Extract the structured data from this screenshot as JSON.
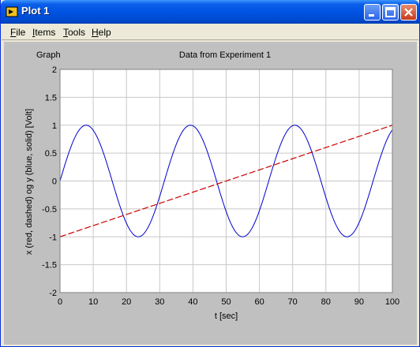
{
  "window": {
    "title": "Plot 1"
  },
  "menu": [
    {
      "label": "File",
      "mnemonic": "F",
      "rest": "ile"
    },
    {
      "label": "Items",
      "mnemonic": "I",
      "rest": "tems"
    },
    {
      "label": "Tools",
      "mnemonic": "T",
      "rest": "ools"
    },
    {
      "label": "Help",
      "mnemonic": "H",
      "rest": "elp"
    }
  ],
  "graph": {
    "label": "Graph"
  },
  "chart_data": {
    "type": "line",
    "title": "Data from Experiment 1",
    "xlabel": "t [sec]",
    "ylabel": "x (red, dashed) og y (blue, solid) [Volt]",
    "xlim": [
      0,
      100
    ],
    "ylim": [
      -2,
      2
    ],
    "xticks": [
      0,
      10,
      20,
      30,
      40,
      50,
      60,
      70,
      80,
      90,
      100
    ],
    "yticks": [
      -2,
      -1.5,
      -1,
      -0.5,
      0,
      0.5,
      1,
      1.5,
      2
    ],
    "grid": true,
    "series": [
      {
        "function": "y = sin(2*pi*t/31.4)",
        "period": 31.4,
        "amplitude": 1,
        "color": "#0000cc",
        "style": "solid",
        "x": [
          0,
          7.85,
          15.7,
          23.55,
          31.4,
          39.25,
          47.1,
          54.95,
          62.8,
          70.65,
          78.5,
          86.35,
          94.2,
          100
        ],
        "y": [
          0,
          1,
          0,
          -1,
          0,
          1,
          0,
          -1,
          0,
          1,
          0,
          -1,
          0,
          0.93
        ]
      },
      {
        "function": "x = -1 + 0.02*t",
        "color": "#cc0000",
        "style": "dashed",
        "x": [
          0,
          100
        ],
        "y": [
          -1,
          1
        ]
      }
    ]
  },
  "colors": {
    "titlebar": "#0054e3",
    "panel_bg": "#c0c0c0",
    "plot_bg": "#ffffff",
    "grid": "#c8c8c8"
  }
}
